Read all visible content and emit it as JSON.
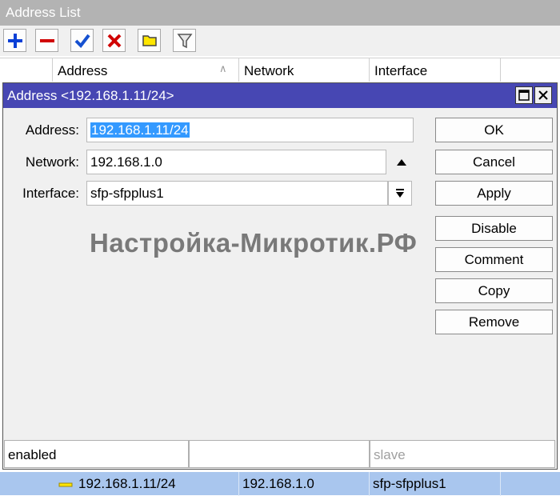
{
  "window": {
    "title": "Address List"
  },
  "toolbar": {
    "buttons": [
      {
        "name": "add",
        "icon": "plus-icon",
        "color": "#0a3fd6"
      },
      {
        "name": "remove",
        "icon": "minus-icon",
        "color": "#d00000"
      },
      {
        "name": "enable",
        "icon": "checkmark-icon",
        "color": "#1550d0"
      },
      {
        "name": "disable",
        "icon": "x-icon",
        "color": "#d00000"
      },
      {
        "name": "comment",
        "icon": "note-icon",
        "color": "#ffe600"
      },
      {
        "name": "filter",
        "icon": "filter-icon",
        "color": "#666666"
      }
    ]
  },
  "list": {
    "columns": [
      "Address",
      "Network",
      "Interface"
    ],
    "sort_indicator": "∧",
    "rows": [
      {
        "address": "192.168.1.11/24",
        "network": "192.168.1.0",
        "interface": "sfp-sfpplus1"
      }
    ]
  },
  "dialog": {
    "title": "Address <192.168.1.11/24>",
    "fields": {
      "address": {
        "label": "Address:",
        "value": "192.168.1.11/24"
      },
      "network": {
        "label": "Network:",
        "value": "192.168.1.0"
      },
      "interface": {
        "label": "Interface:",
        "value": "sfp-sfpplus1"
      }
    },
    "buttons": {
      "ok": "OK",
      "cancel": "Cancel",
      "apply": "Apply",
      "disable": "Disable",
      "comment": "Comment",
      "copy": "Copy",
      "remove": "Remove"
    },
    "status": {
      "state": "enabled",
      "middle": "",
      "slave": "slave"
    }
  },
  "watermark": "Настройка-Микротик.РФ",
  "colors": {
    "dialog_title_bg": "#4747b3",
    "selected_row_bg": "#a9c6ee",
    "selection_highlight": "#3399ff"
  }
}
